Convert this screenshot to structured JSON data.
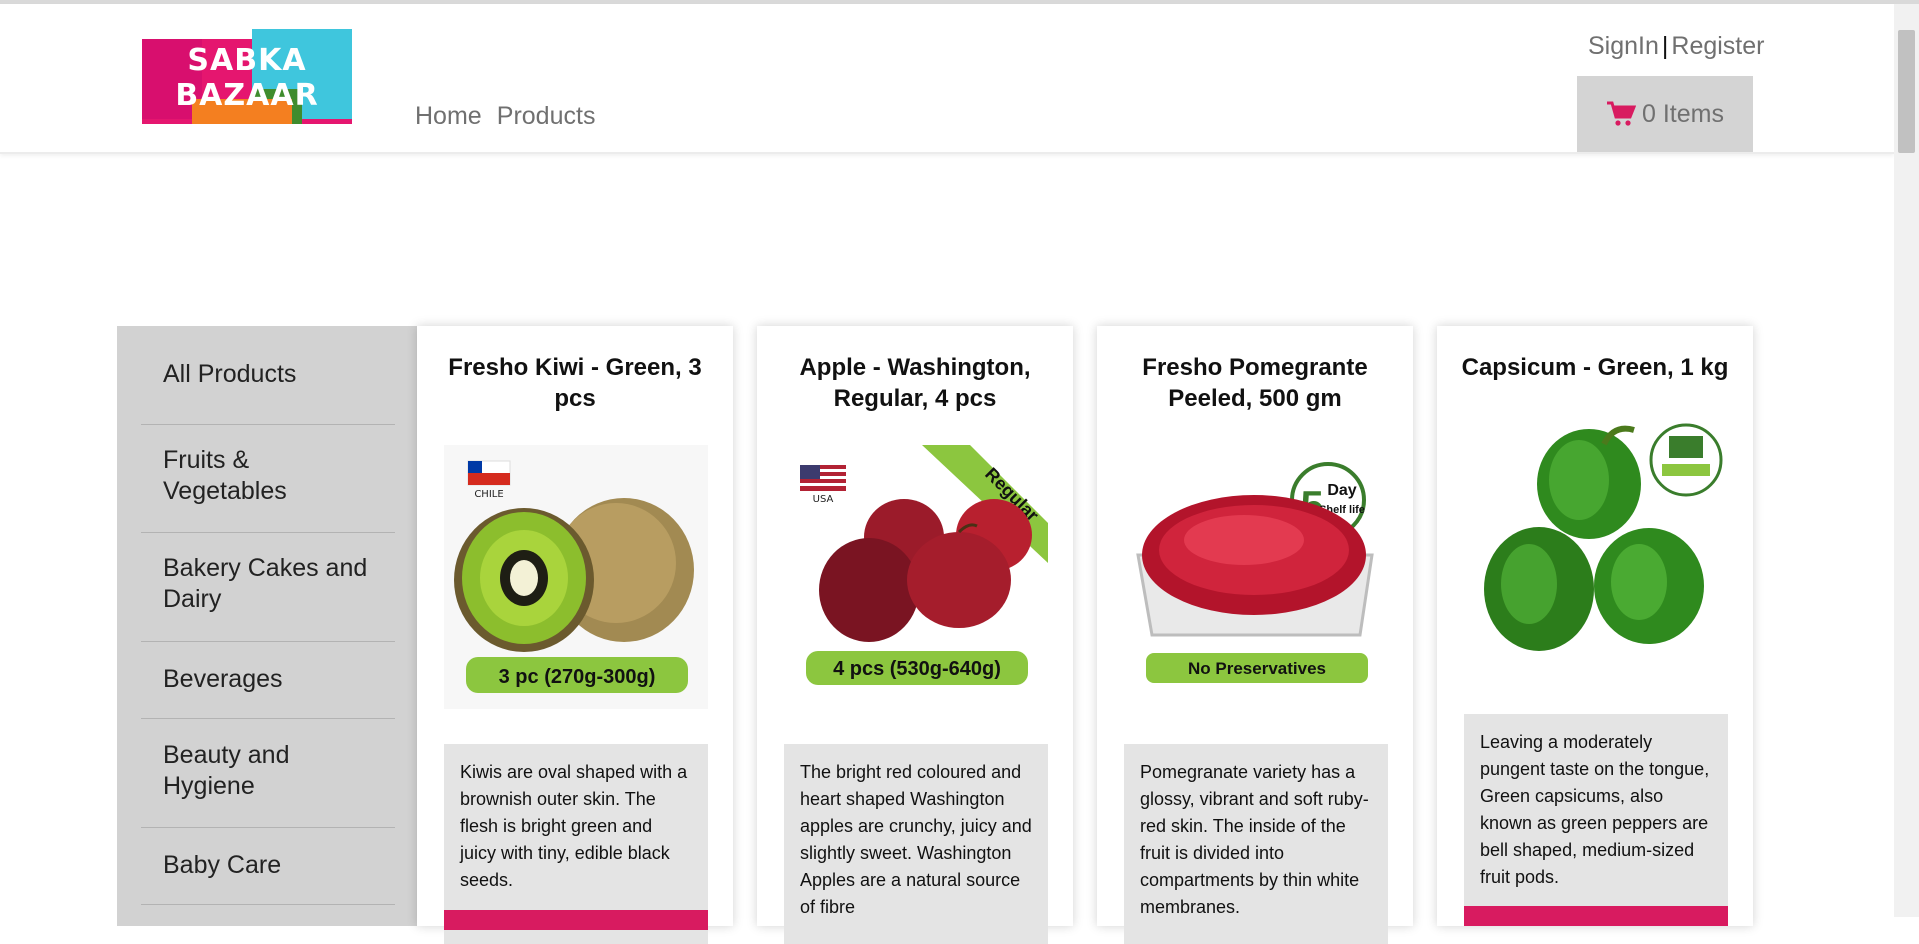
{
  "brand": {
    "logo_line1": "SABKA",
    "logo_line2": "BAZAAR"
  },
  "nav": {
    "home": "Home",
    "products": "Products"
  },
  "auth": {
    "signin": "SignIn",
    "separator": "|",
    "register": "Register"
  },
  "cart": {
    "label": "0 Items",
    "icon": "cart-icon"
  },
  "sidebar": {
    "items": [
      {
        "label": "All Products"
      },
      {
        "label": "Fruits & Vegetables"
      },
      {
        "label": "Bakery Cakes and Dairy"
      },
      {
        "label": "Beverages"
      },
      {
        "label": "Beauty and Hygiene"
      },
      {
        "label": "Baby Care"
      }
    ]
  },
  "products": [
    {
      "name": "Fresho Kiwi - Green, 3 pcs",
      "badge": "3 pc (270g-300g)",
      "flag_label": "CHILE",
      "description": "Kiwis are oval shaped with a brownish outer skin. The flesh is bright green and juicy with tiny, edible black seeds."
    },
    {
      "name": "Apple - Washington, Regular, 4 pcs",
      "badge": "4 pcs (530g-640g)",
      "flag_label": "USA",
      "ribbon": "Regular",
      "description": "The bright red coloured and heart shaped Washington apples are crunchy, juicy and slightly sweet. Washington Apples are a natural source of fibre"
    },
    {
      "name": "Fresho Pomegrante Peeled, 500 gm",
      "badge": "No Preservatives",
      "shelf_number": "5",
      "shelf_day": "Day",
      "shelf_text": "Shelf life",
      "description": "Pomegranate variety has a glossy, vibrant and soft ruby-red skin. The inside of the fruit is divided into compartments by thin white membranes."
    },
    {
      "name": "Capsicum - Green, 1 kg",
      "description": "Leaving a moderately pungent taste on the tongue, Green capsicums, also known as green peppers are bell shaped, medium-sized fruit pods."
    }
  ],
  "colors": {
    "accent": "#d81b60",
    "cart_bg": "#d4d4d4",
    "sidebar_bg": "#d2d2d2"
  }
}
